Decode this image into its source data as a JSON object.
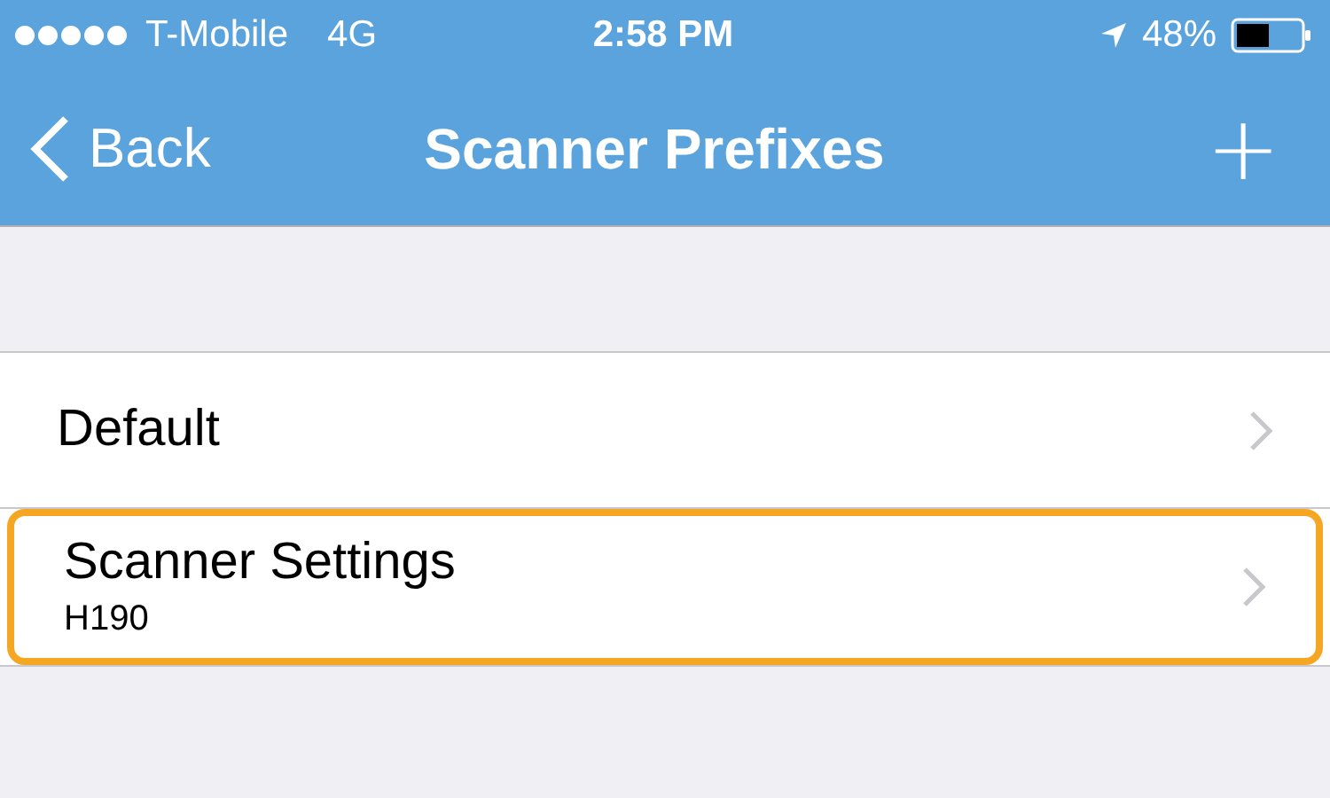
{
  "status_bar": {
    "carrier": "T-Mobile",
    "network": "4G",
    "time": "2:58 PM",
    "battery": "48%"
  },
  "nav_bar": {
    "back": "Back",
    "title": "Scanner Prefixes",
    "action": "+"
  },
  "rows": [
    {
      "title": "Default",
      "highlighted": false
    },
    {
      "title": "Scanner Settings",
      "subtitle": "H190",
      "highlighted": true
    }
  ]
}
